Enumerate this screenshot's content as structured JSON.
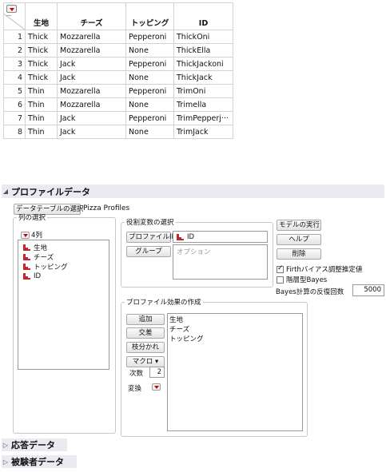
{
  "table": {
    "columns": [
      "生地",
      "チーズ",
      "トッピング",
      "ID"
    ],
    "rows": [
      {
        "n": "1",
        "crust": "Thick",
        "cheese": "Mozzarella",
        "topping": "Pepperoni",
        "id": "ThickOni"
      },
      {
        "n": "2",
        "crust": "Thick",
        "cheese": "Mozzarella",
        "topping": "None",
        "id": "ThickElla"
      },
      {
        "n": "3",
        "crust": "Thick",
        "cheese": "Jack",
        "topping": "Pepperoni",
        "id": "ThickJackoni"
      },
      {
        "n": "4",
        "crust": "Thick",
        "cheese": "Jack",
        "topping": "None",
        "id": "ThickJack"
      },
      {
        "n": "5",
        "crust": "Thin",
        "cheese": "Mozzarella",
        "topping": "Pepperoni",
        "id": "TrimOni"
      },
      {
        "n": "6",
        "crust": "Thin",
        "cheese": "Mozzarella",
        "topping": "None",
        "id": "Trimella"
      },
      {
        "n": "7",
        "crust": "Thin",
        "cheese": "Jack",
        "topping": "Pepperoni",
        "id": "TrimPepperj···"
      },
      {
        "n": "8",
        "crust": "Thin",
        "cheese": "Jack",
        "topping": "None",
        "id": "TrimJack"
      }
    ]
  },
  "profile": {
    "title": "プロファイルデータ",
    "select_table_button": "データテーブルの選択",
    "table_name": "Pizza Profiles",
    "columns_group": {
      "legend": "列の選択",
      "count": "4列",
      "items": [
        "生地",
        "チーズ",
        "トッピング",
        "ID"
      ]
    },
    "roles_group": {
      "legend": "役割変数の選択",
      "profile_id_button": "プロファイルID",
      "profile_id_value": "ID",
      "group_button": "グループ",
      "group_placeholder": "オプション"
    },
    "actions": {
      "run": "モデルの実行",
      "help": "ヘルプ",
      "remove": "削除",
      "firth_label": "Firthバイアス調整推定値",
      "firth_checked": true,
      "bayes_label": "階層型Bayes",
      "bayes_checked": false,
      "iterations_label": "Bayes計算の反復回数",
      "iterations_value": "5000"
    },
    "effects_group": {
      "legend": "プロファイル効果の作成",
      "add": "追加",
      "cross": "交差",
      "nest": "枝分かれ",
      "macro": "マクロ ▾",
      "degree_label": "次数",
      "degree_value": "2",
      "transform_label": "変換",
      "effects": [
        "生地",
        "チーズ",
        "トッピング"
      ]
    }
  },
  "sections": {
    "response": "応答データ",
    "subject": "被験者データ"
  },
  "colors": {
    "accent_red": "#c1272d",
    "outline_header": "#eaeaf2"
  }
}
